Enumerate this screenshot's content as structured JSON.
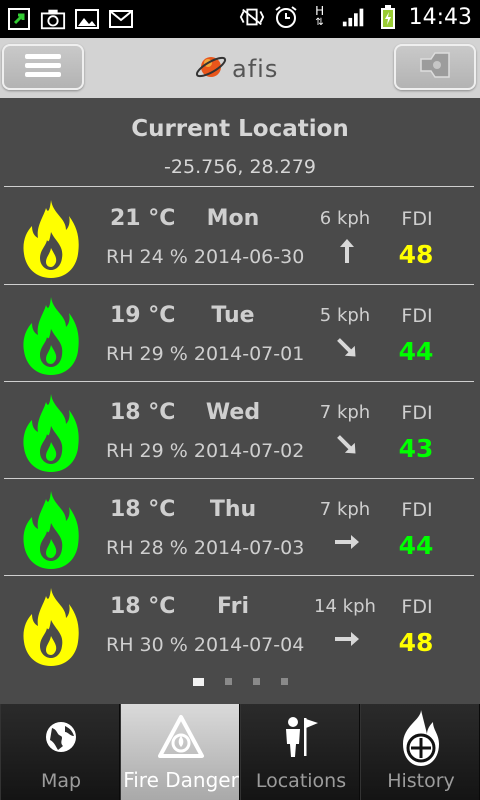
{
  "status_bar": {
    "time": "14:43",
    "network": "H"
  },
  "app": {
    "logo_text": "afis"
  },
  "location": {
    "title": "Current Location",
    "coords": "-25.756, 28.279"
  },
  "forecast": [
    {
      "temp": "21 °C",
      "day": "Mon",
      "rh": "RH  24 %",
      "date": "2014-06-30",
      "wind": "6 kph",
      "wind_direction": "north",
      "fdi_label": "FDI",
      "fdi": "48",
      "level_color": "#ffff00"
    },
    {
      "temp": "19 °C",
      "day": "Tue",
      "rh": "RH  29 %",
      "date": "2014-07-01",
      "wind": "5 kph",
      "wind_direction": "south-east",
      "fdi_label": "FDI",
      "fdi": "44",
      "level_color": "#00ff00"
    },
    {
      "temp": "18 °C",
      "day": "Wed",
      "rh": "RH  29 %",
      "date": "2014-07-02",
      "wind": "7 kph",
      "wind_direction": "south-east",
      "fdi_label": "FDI",
      "fdi": "43",
      "level_color": "#00ff00"
    },
    {
      "temp": "18 °C",
      "day": "Thu",
      "rh": "RH  28 %",
      "date": "2014-07-03",
      "wind": "7 kph",
      "wind_direction": "east",
      "fdi_label": "FDI",
      "fdi": "44",
      "level_color": "#00ff00"
    },
    {
      "temp": "18 °C",
      "day": "Fri",
      "rh": "RH  30 %",
      "date": "2014-07-04",
      "wind": "14 kph",
      "wind_direction": "east",
      "fdi_label": "FDI",
      "fdi": "48",
      "level_color": "#ffff00"
    }
  ],
  "pager": {
    "pages": 4,
    "active": 1
  },
  "tabs": [
    {
      "label": "Map",
      "icon": "globe-icon",
      "selected": false
    },
    {
      "label": "Fire Danger",
      "icon": "fire-warning-icon",
      "selected": true
    },
    {
      "label": "Locations",
      "icon": "person-flag-icon",
      "selected": false
    },
    {
      "label": "History",
      "icon": "flame-clock-icon",
      "selected": false
    }
  ]
}
